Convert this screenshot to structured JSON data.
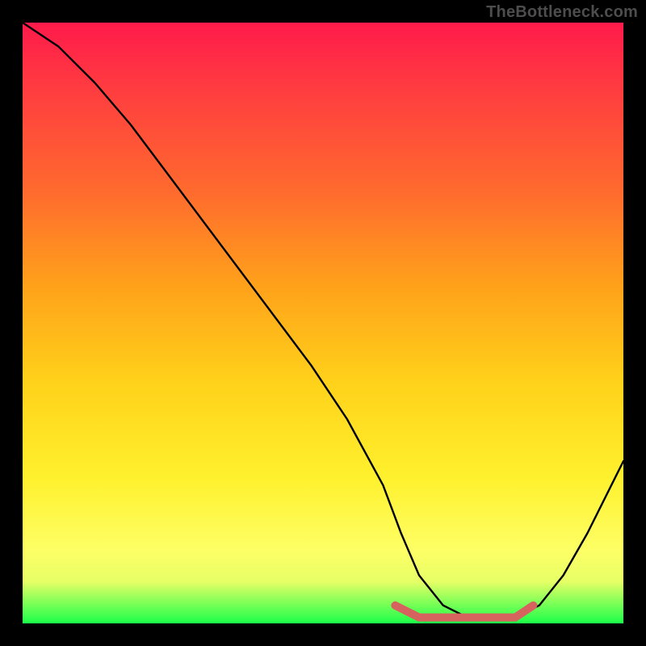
{
  "watermark": "TheBottleneck.com",
  "chart_data": {
    "type": "line",
    "title": "",
    "xlabel": "",
    "ylabel": "",
    "xlim": [
      0,
      100
    ],
    "ylim": [
      0,
      100
    ],
    "grid": false,
    "series": [
      {
        "name": "main-curve",
        "color": "#000000",
        "x": [
          0,
          6,
          12,
          18,
          24,
          30,
          36,
          42,
          48,
          54,
          60,
          63,
          66,
          70,
          74,
          78,
          82,
          86,
          90,
          94,
          100
        ],
        "values": [
          100,
          96,
          90,
          83,
          75,
          67,
          59,
          51,
          43,
          34,
          23,
          15,
          8,
          3,
          1,
          1,
          1,
          3,
          8,
          15,
          27
        ]
      },
      {
        "name": "bottom-band",
        "color": "#d6635e",
        "x": [
          62,
          66,
          70,
          74,
          78,
          82,
          85
        ],
        "values": [
          3,
          1,
          1,
          1,
          1,
          1,
          3
        ]
      }
    ]
  }
}
